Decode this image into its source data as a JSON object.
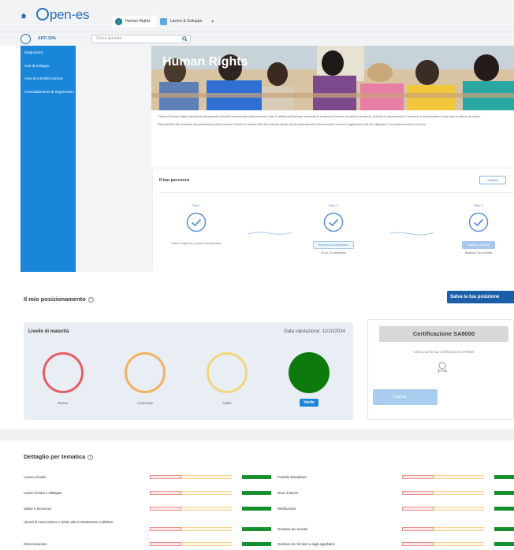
{
  "app": {
    "logo_text": "pen-es"
  },
  "tabs": [
    {
      "label": "Human Rights",
      "icon": "globe-icon",
      "active": true
    },
    {
      "label": "Lavoro & Sviluppo",
      "icon": "folder-icon",
      "active": false
    }
  ],
  "subheader": {
    "company_name": "ARTI SPA",
    "search_placeholder": "Cerca azienda"
  },
  "sidebar": {
    "items": [
      {
        "label": "Diagnostica"
      },
      {
        "label": "Hub di Sviluppo"
      },
      {
        "label": "Area di e-Mobilizzazione"
      },
      {
        "label": "Consolidamento di Segmentato"
      }
    ]
  },
  "hero": {
    "title": "Human Rights"
  },
  "intro": {
    "paragraphs": [
      "Il tema di Human Rights riguarda la salvaguardia dei diritti fondamentali della persona in tutte le attività dell'impresa, valutando le condizioni di lavoro, la salute e sicurezza, la libertà di associazione e l'assenza di discriminazioni lungo tutta la catena del valore.",
      "Rispondendo alle domande del questionario potrai misurare il livello di maturità della tua azienda rispetto ai principali standard internazionali e ricevere suggerimenti utili per migliorare il tuo posizionamento sul tema."
    ]
  },
  "path": {
    "title": "Il tuo percorso",
    "button": "Guarda",
    "steps": [
      {
        "label": "Step 1",
        "desc": "Entra in Open-es e avvia il tuo percorso",
        "pill": "",
        "sub": ""
      },
      {
        "label": "Step 2",
        "desc": "",
        "pill": "Rispondi al questionario",
        "sub": "10 su 10 completate"
      },
      {
        "label": "Step 3",
        "desc": "",
        "pill": "Analizza i risultati",
        "sub": "Analizza i tuoi risultati"
      }
    ]
  },
  "positioning": {
    "title": "Il mio posizionamento",
    "save_button": "Salva la tua posizione"
  },
  "maturity": {
    "title": "Livello di maturità",
    "date": "Data valutazione: 11/10/2024",
    "levels": [
      {
        "label": "Rosso",
        "color": "#e35d63",
        "selected": false
      },
      {
        "label": "Arancione",
        "color": "#f3b15d",
        "selected": false
      },
      {
        "label": "Giallo",
        "color": "#f2d77a",
        "selected": false
      },
      {
        "label": "Verde",
        "color": "#0d7a0d",
        "selected": true
      }
    ]
  },
  "certification": {
    "title": "Certificazione SA8000",
    "subtitle": "Carica qui la tua certificazione SA8000",
    "button": "Carica"
  },
  "thematic": {
    "title": "Dettaglio per tematica",
    "rows": [
      {
        "left": "Lavoro minorile",
        "right": "Pratiche Disciplinari"
      },
      {
        "left": "Lavoro forzato o obbligato",
        "right": "Orari di lavoro"
      },
      {
        "left": "Salute e Sicurezza",
        "right": "Retribuzione"
      },
      {
        "left": "Libertà di Associazione e Diritto alla Contrattazione Collettiva",
        "right": "Gestione dei reclami"
      },
      {
        "left": "Discriminazione",
        "right": "Gestione dei fornitori e degli appaltatori"
      }
    ]
  }
}
